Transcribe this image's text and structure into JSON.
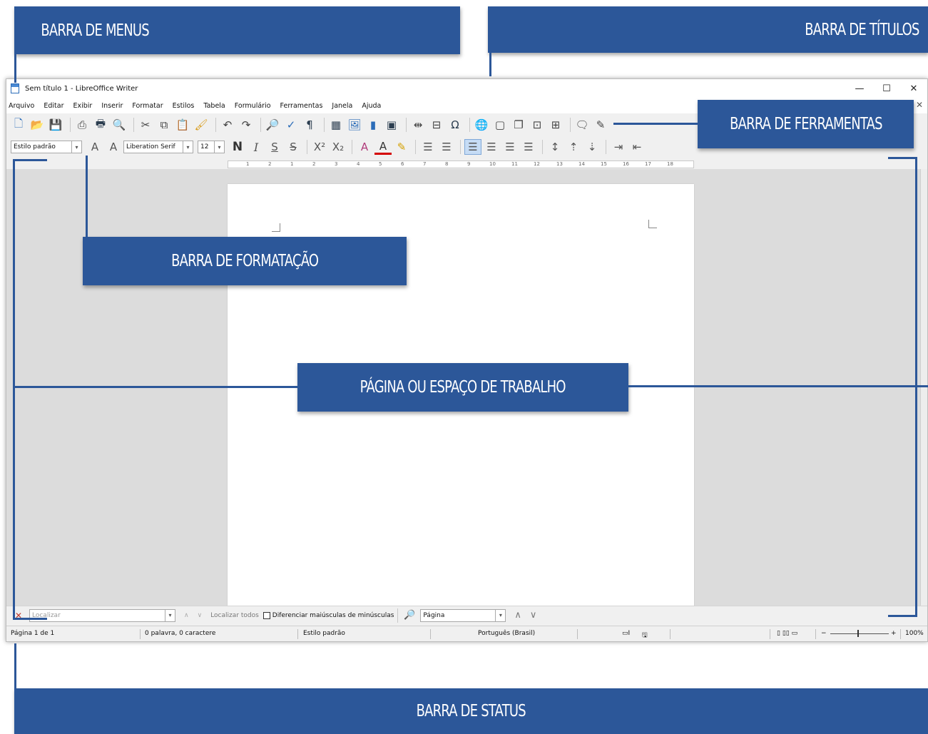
{
  "window": {
    "title": "Sem título 1 - LibreOffice Writer",
    "controls": {
      "minimize": "—",
      "maximize": "☐",
      "close": "✕"
    },
    "close_document": "✕"
  },
  "menubar": [
    "Arquivo",
    "Editar",
    "Exibir",
    "Inserir",
    "Formatar",
    "Estilos",
    "Tabela",
    "Formulário",
    "Ferramentas",
    "Janela",
    "Ajuda"
  ],
  "formatting": {
    "paragraph_style": "Estilo padrão",
    "font_name": "Liberation Serif",
    "font_size": "12"
  },
  "ruler": [
    "1",
    "2",
    "1",
    "2",
    "3",
    "4",
    "5",
    "6",
    "7",
    "8",
    "9",
    "10",
    "11",
    "12",
    "13",
    "14",
    "15",
    "16",
    "17",
    "18"
  ],
  "findbar": {
    "placeholder": "Localizar",
    "find_all": "Localizar todos",
    "match_case": "Diferenciar maiúsculas de minúsculas",
    "navigate_by": "Página"
  },
  "statusbar": {
    "page": "Página 1 de 1",
    "words": "0 palavra, 0 caractere",
    "style": "Estilo padrão",
    "language": "Português (Brasil)",
    "zoom": "100%"
  },
  "callouts": {
    "menus": "BARRA DE MENUS",
    "titles": "BARRA DE TÍTULOS",
    "tools": "BARRA DE FERRAMENTAS",
    "formatting": "BARRA DE FORMATAÇÃO",
    "workspace": "PÁGINA OU ESPAÇO DE TRABALHO",
    "status": "BARRA DE STATUS"
  },
  "colors": {
    "callout": "#2c5799",
    "accent": "#2b6cb8"
  }
}
